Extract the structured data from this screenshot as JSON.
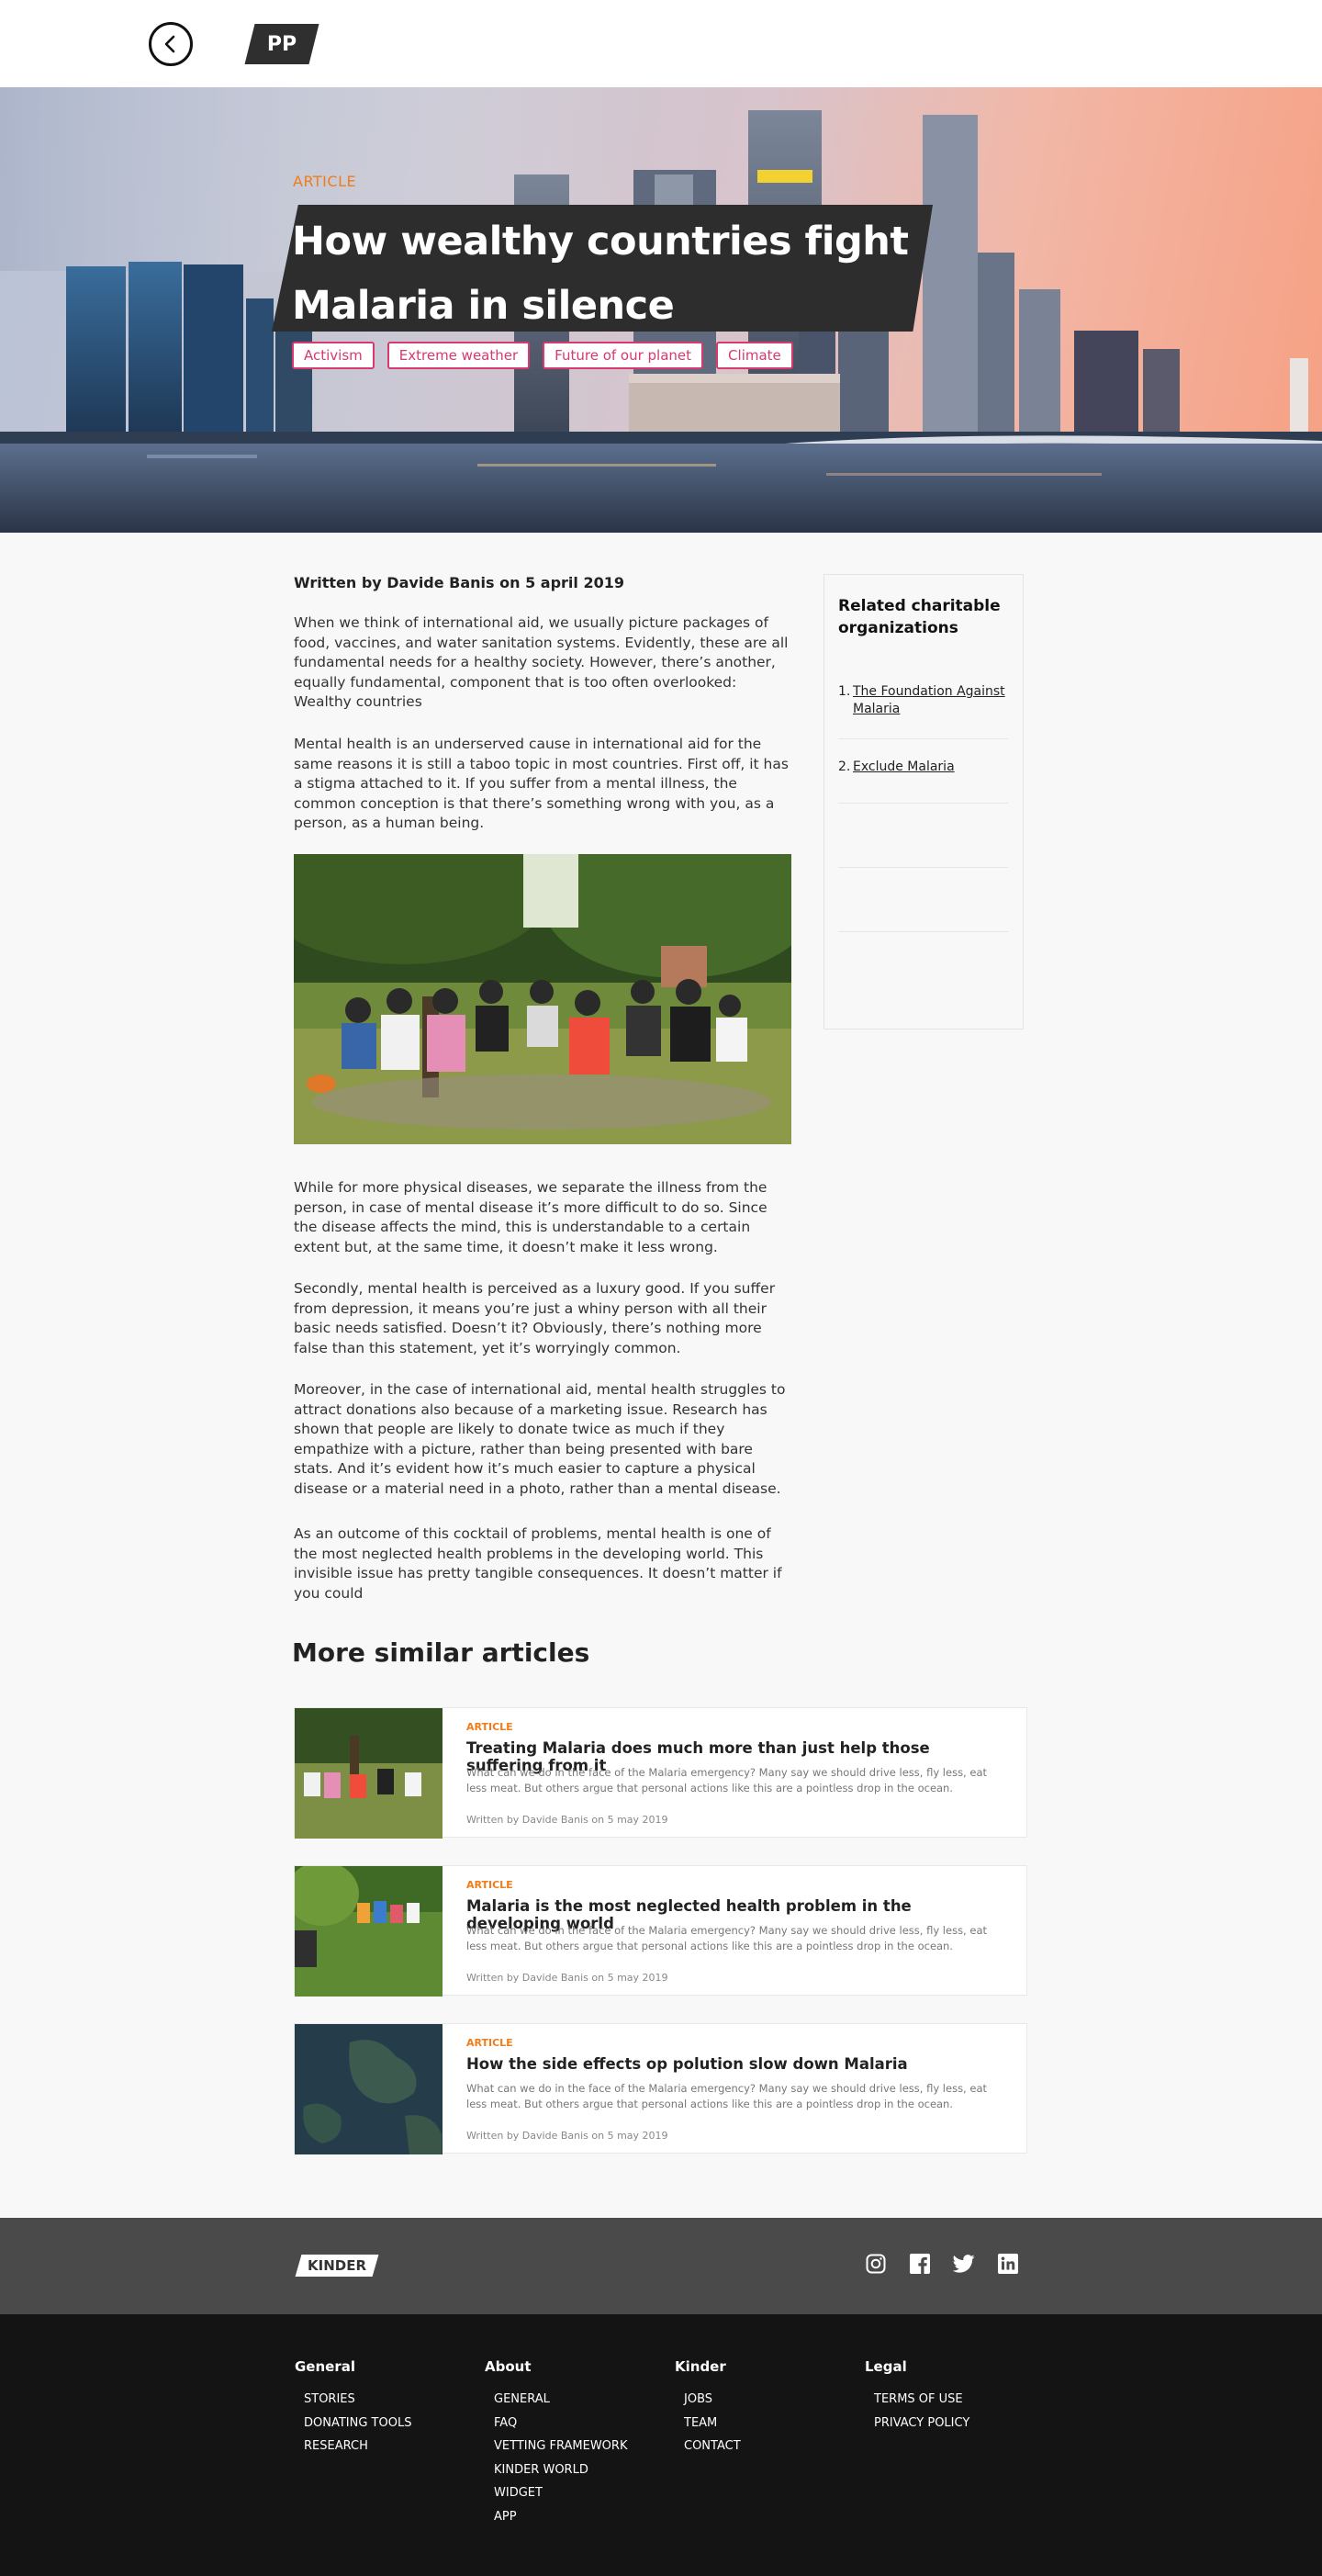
{
  "header": {
    "back_icon": "chevron-left-icon",
    "logo_text": "PP"
  },
  "hero": {
    "kicker": "ARTICLE",
    "title": "How wealthy countries fight Malaria in silence",
    "tags": [
      "Activism",
      "Extreme weather",
      "Future of our planet",
      "Climate"
    ],
    "accent_color": "#d63a6e",
    "kicker_color": "#f07c1a"
  },
  "article": {
    "byline": "Written by Davide Banis on 5 april 2019",
    "paragraphs": [
      "When we think of international aid, we usually picture packages of food, vaccines, and water sanitation systems. Evidently, these are all fundamental needs for a  healthy society. However, there’s another, equally fundamental, component that is too often overlooked:  Wealthy countries",
      "Mental health is an underserved cause in international aid for the same reasons it is still a taboo topic in most countries. First off, it has a stigma attached to it. If you suffer from a mental illness, the common conception is that there’s something wrong with you, as a person, as a human being.",
      "While for more physical diseases, we separate the illness from the person, in case of mental disease it’s more difficult to do so. Since the disease affects the mind, this is understandable to a certain extent but, at the same time, it doesn’t make it less wrong.",
      "Secondly, mental health is perceived as a luxury good. If you suffer from depression, it means you’re just a whiny person with all their basic needs satisfied. Doesn’t it? Obviously, there’s nothing more false than this statement, yet it’s worryingly common.",
      "Moreover, in the case of international aid, mental health struggles to attract donations also because of a marketing issue. Research has shown that people are likely to donate twice as much if they empathize with a picture, rather than being presented with bare stats. And it’s evident how it’s much easier to capture a physical disease or a material need in a photo, rather than a mental disease.",
      "As an outcome of this cocktail of problems, mental health is one of the most neglected health problems in the developing world. This invisible issue has pretty tangible consequences. It doesn’t matter if you could"
    ]
  },
  "sidebar": {
    "title": "Related charitable organizations",
    "items": [
      {
        "num": "1.",
        "label": "The Foundation Against Malaria"
      },
      {
        "num": "2.",
        "label": "Exclude Malaria"
      }
    ]
  },
  "similar": {
    "heading": "More similar articles",
    "cards": [
      {
        "kicker": "ARTICLE",
        "title": "Treating Malaria does much more than just help those suffering from it",
        "excerpt": "What can we do in the face of the Malaria emergency? Many say we should drive less, fly less, eat less meat. But others argue that personal actions like this are a pointless drop in the ocean.",
        "meta": "Written by Davide Banis on 5 may 2019"
      },
      {
        "kicker": "ARTICLE",
        "title": "Malaria is the most neglected health problem in the developing world",
        "excerpt": "What can we do in the face of the Malaria emergency? Many say we should drive less, fly less, eat less meat. But others argue that personal actions like this are a pointless drop in the ocean.",
        "meta": "Written by Davide Banis on 5 may 2019"
      },
      {
        "kicker": "ARTICLE",
        "title": "How the side effects op polution slow down Malaria",
        "excerpt": "What can we do in the face of the Malaria emergency? Many say we should drive less, fly less, eat less meat. But others argue that personal actions like this are a pointless drop in the ocean.",
        "meta": "Written by Davide Banis on 5 may 2019"
      }
    ]
  },
  "footer": {
    "logo_text": "KINDER",
    "social_icons": [
      "instagram-icon",
      "facebook-icon",
      "twitter-icon",
      "linkedin-icon"
    ],
    "columns": [
      {
        "title": "General",
        "links": [
          "STORIES",
          "DONATING TOOLS",
          "RESEARCH"
        ]
      },
      {
        "title": "About",
        "links": [
          "GENERAL",
          "FAQ",
          "VETTING FRAMEWORK",
          "KINDER WORLD",
          "WIDGET",
          "APP"
        ]
      },
      {
        "title": "Kinder",
        "links": [
          "JOBS",
          "TEAM",
          "CONTACT"
        ]
      },
      {
        "title": "Legal",
        "links": [
          "TERMS OF USE",
          "PRIVACY POLICY"
        ]
      }
    ]
  }
}
